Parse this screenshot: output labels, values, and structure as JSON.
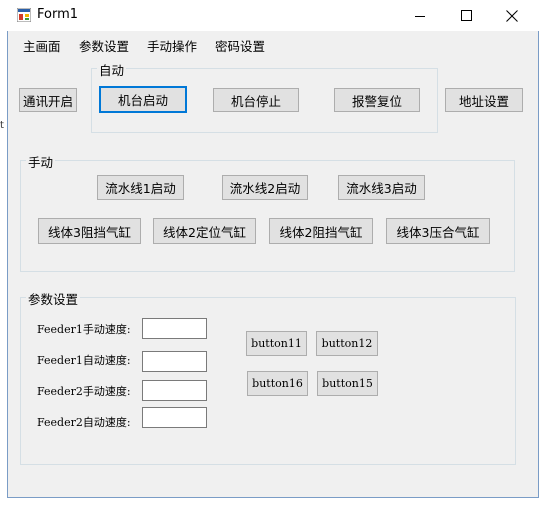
{
  "window": {
    "title": "Form1",
    "icon": "app-form-icon"
  },
  "caption": {
    "minimize_icon": "minimize-icon",
    "maximize_icon": "maximize-icon",
    "close_icon": "close-icon"
  },
  "menu": [
    "主画面",
    "参数设置",
    "手动操作",
    "密码设置"
  ],
  "left_edge_text": "t",
  "top_buttons": {
    "comm_open": "通讯开启",
    "address_settings": "地址设置"
  },
  "auto_group": {
    "label": "自动",
    "start": "机台启动",
    "stop": "机台停止",
    "alarm_reset": "报警复位"
  },
  "manual_group": {
    "label": "手动",
    "line1_start": "流水线1启动",
    "line2_start": "流水线2启动",
    "line3_start": "流水线3启动",
    "body3_stop_cyl": "线体3阻挡气缸",
    "body2_pos_cyl": "线体2定位气缸",
    "body2_stop_cyl": "线体2阻挡气缸",
    "body3_press_cyl": "线体3压合气缸"
  },
  "params_group": {
    "label": "参数设置",
    "fields": [
      {
        "label": "Feeder1手动速度:",
        "value": ""
      },
      {
        "label": "Feeder1自动速度:",
        "value": ""
      },
      {
        "label": "Feeder2手动速度:",
        "value": ""
      },
      {
        "label": "Feeder2自动速度:",
        "value": ""
      }
    ],
    "button11": "button11",
    "button12": "button12",
    "button16": "button16",
    "button15": "button15"
  }
}
